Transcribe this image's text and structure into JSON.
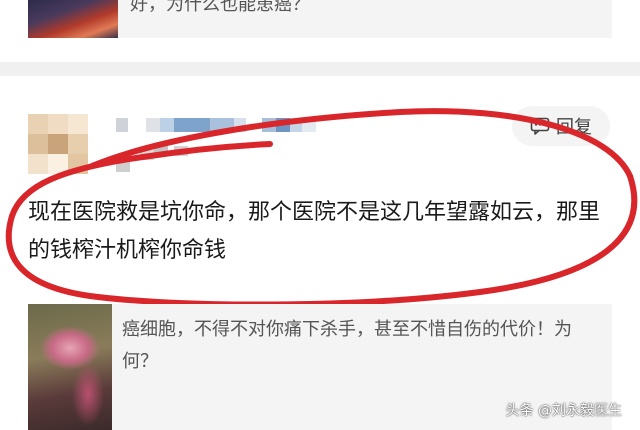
{
  "previous_card": {
    "text": "好，为什么也能患癌？"
  },
  "comment": {
    "reply_label": "回复",
    "text": "现在医院救是坑你命，那个医院不是这几年望露如云，那里的钱榨汁机榨你命钱"
  },
  "quoted_article": {
    "text": "癌细胞，不得不对你痛下杀手，甚至不惜自伤的代价！为何？"
  },
  "watermark": "头条 @刘永毅医生",
  "colors": {
    "highlight_circle": "#d8262b",
    "card_bg": "#f4f4f4",
    "divider": "#f0f0f0"
  }
}
